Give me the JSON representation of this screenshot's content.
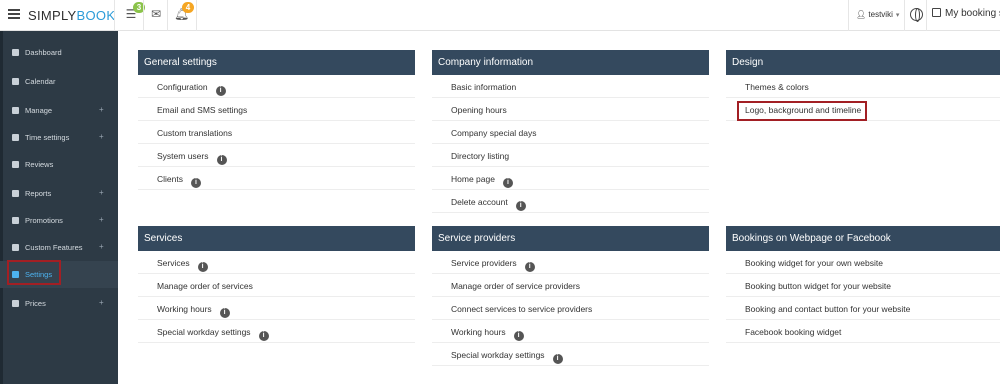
{
  "brand": {
    "part1": "SIMPLY",
    "part2": "BOOK"
  },
  "topbar": {
    "badges": {
      "bookings": "3",
      "notifications": "4"
    },
    "badge_colors": {
      "bookings": "#8bc34a",
      "notifications": "#f5a623"
    },
    "user": "testviki",
    "booking_site": "My booking s"
  },
  "sidebar": {
    "items": [
      {
        "label": "Dashboard",
        "plus": ""
      },
      {
        "label": "Calendar",
        "plus": ""
      },
      {
        "label": "Manage",
        "plus": "+"
      },
      {
        "label": "Time settings",
        "plus": "+"
      },
      {
        "label": "Reviews",
        "plus": ""
      },
      {
        "label": "Reports",
        "plus": "+"
      },
      {
        "label": "Promotions",
        "plus": "+"
      },
      {
        "label": "Custom Features",
        "plus": "+"
      },
      {
        "label": "Settings",
        "plus": ""
      },
      {
        "label": "Prices",
        "plus": "+"
      }
    ],
    "active": "Settings"
  },
  "panels": {
    "general": {
      "title": "General settings",
      "rows": [
        "Configuration",
        "Email and SMS settings",
        "Custom translations",
        "System users",
        "Clients"
      ]
    },
    "company": {
      "title": "Company information",
      "rows": [
        "Basic information",
        "Opening hours",
        "Company special days",
        "Directory listing",
        "Home page",
        "Delete account"
      ]
    },
    "design": {
      "title": "Design",
      "rows": [
        "Themes & colors",
        "Logo, background and timeline"
      ]
    },
    "services": {
      "title": "Services",
      "rows": [
        "Services",
        "Manage order of services",
        "Working hours",
        "Special workday settings"
      ]
    },
    "providers": {
      "title": "Service providers",
      "rows": [
        "Service providers",
        "Manage order of service providers",
        "Connect services to service providers",
        "Working hours",
        "Special workday settings"
      ]
    },
    "widgets": {
      "title": "Bookings on Webpage or Facebook",
      "rows": [
        "Booking widget for your own website",
        "Booking button widget for your website",
        "Booking and contact button for your website",
        "Facebook booking widget"
      ]
    }
  },
  "accent": "#34495e",
  "highlight_color": "#a21f24"
}
